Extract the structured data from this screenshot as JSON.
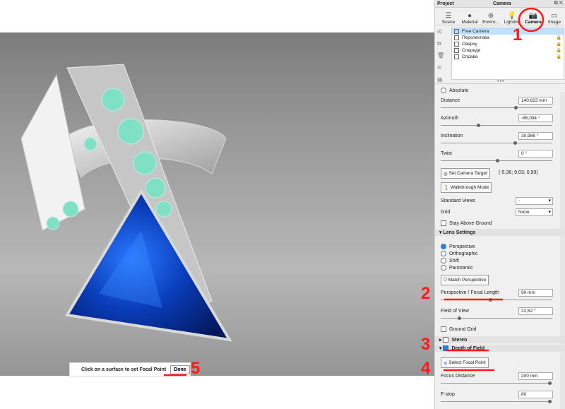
{
  "titlebar": {
    "project": "Project",
    "camera": "Camera"
  },
  "tabs": [
    {
      "label": "Scene",
      "icon": "scene-icon"
    },
    {
      "label": "Material",
      "icon": "material-icon"
    },
    {
      "label": "Enviro...",
      "icon": "environment-icon"
    },
    {
      "label": "Lighting",
      "icon": "lighting-icon"
    },
    {
      "label": "Camera",
      "icon": "camera-icon",
      "active": true
    },
    {
      "label": "Image",
      "icon": "image-icon"
    }
  ],
  "cameras": [
    "Free Camera",
    "Перспектива",
    "Сверху",
    "Спереди",
    "Справа"
  ],
  "props": {
    "absolute": "Absolute",
    "distance_label": "Distance",
    "distance": "140,623 mm",
    "azimuth_label": "Azimuth",
    "azimuth": "-66,094 °",
    "inclination_label": "Inclination",
    "inclination": "30,986 °",
    "twist_label": "Twist",
    "twist": "0 °",
    "set_target": "Set Camera Target",
    "target_coords": "(-5,36; 9,03; 0,99)",
    "walkthrough": "Walkthrough Mode",
    "standard_views_label": "Standard Views",
    "standard_views": "-",
    "grid_label": "Grid",
    "grid": "None",
    "stay_above": "Stay Above Ground"
  },
  "lens": {
    "title": "Lens Settings",
    "modes": [
      "Perspective",
      "Orthographic",
      "Shift",
      "Panoramic"
    ],
    "match": "Match Perspective",
    "focal_label": "Perspective / Focal Length",
    "focal": "90 mm",
    "fov_label": "Field of View",
    "fov": "22,62 °",
    "ground_grid": "Ground Grid"
  },
  "stereo": "Stereo",
  "dof": {
    "title": "Depth of Field",
    "select": "Select Focal Point",
    "focus_label": "Focus Distance",
    "focus": "200 mm",
    "fstop_label": "F-stop",
    "fstop": "80"
  },
  "viewport": {
    "focal_prompt": "Click on a surface to set Focal Point",
    "done": "Done"
  },
  "annotations": [
    "1",
    "2",
    "3",
    "4",
    "5"
  ],
  "colors": {
    "accent": "#2b7fd6",
    "annotation": "#ff1a1a",
    "selected_row": "#bfe1ff"
  }
}
